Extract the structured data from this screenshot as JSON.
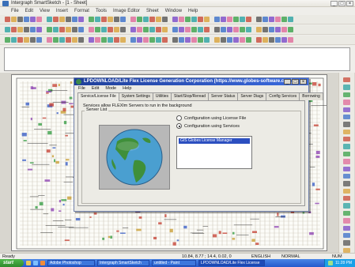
{
  "app": {
    "title": "Intergraph SmartSketch - [1 - Sheet]",
    "window_controls": [
      "_",
      "□",
      "×"
    ]
  },
  "menubar": [
    "File",
    "Edit",
    "View",
    "Insert",
    "Format",
    "Tools",
    "Image Editor",
    "Sheet",
    "Window",
    "Help"
  ],
  "dialog": {
    "title": "LPDOWNLOAD/Lite Flex License Generation Corporation (https://www.globes-software.com)",
    "window_controls": [
      "_",
      "□",
      "×"
    ],
    "menu": [
      "File",
      "Edit",
      "Mode",
      "Help"
    ],
    "tabs": [
      "Service/License File",
      "System Settings",
      "Utilities",
      "Start/Stop/Reread",
      "Server Status",
      "Server Diags",
      "Config Services",
      "Borrowing"
    ],
    "active_tab": "Service/License File",
    "description": "Services allow FLEXlm Servers to run in the background",
    "group_label": "Server List",
    "options": [
      {
        "label": "Configuration using License File",
        "selected": false
      },
      {
        "label": "Configuration using Services",
        "selected": true
      }
    ],
    "service_list": [
      "GIS Globes License Manager"
    ]
  },
  "statusbar": {
    "left": "Ready",
    "coords": "10.84, 8.77 ; 14.4, 0.02, 0",
    "grid": "ENGLISH",
    "mode": "NORMAL",
    "num": "NUM"
  },
  "taskbar": {
    "start": "start",
    "buttons": [
      "Adobe Photoshop",
      "Intergraph SmartSketch",
      "untitled - Paint",
      "LPDOWNLOAD/Lite Flex License"
    ],
    "active_button": 3,
    "clock": "11:28 PM"
  },
  "colors": {
    "taskbar_blue": "#2359cc",
    "dialog_titlebar": "#1f3f9a",
    "selection_blue": "#2c4fc0",
    "start_green": "#2f8a2c"
  }
}
